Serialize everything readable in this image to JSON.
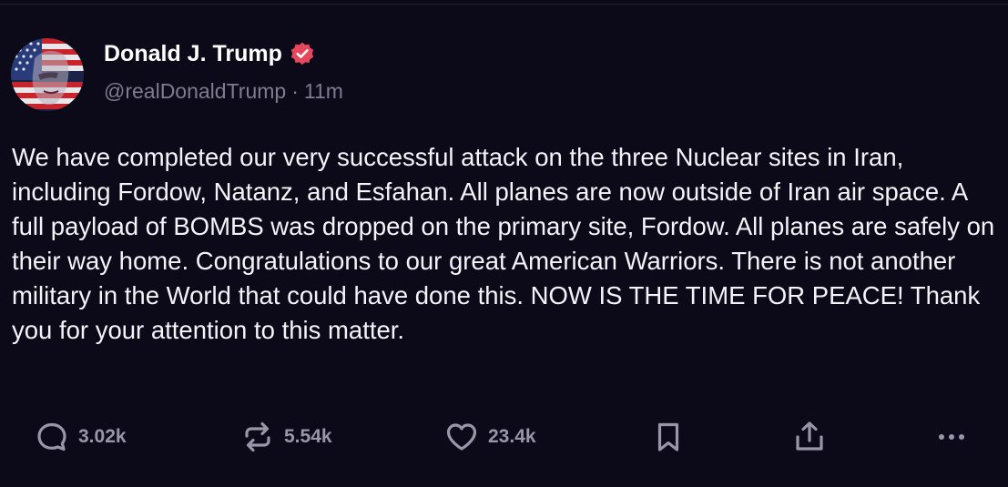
{
  "author": {
    "display_name": "Donald J. Trump",
    "handle": "@realDonaldTrump",
    "separator": "·",
    "timestamp": "11m",
    "verified": true,
    "verified_badge_color": "#e5485d",
    "avatar_icon": "avatar-flag-portrait"
  },
  "post": {
    "text": "We have completed our very successful attack on the three Nuclear sites in Iran, including Fordow, Natanz, and Esfahan. All planes are now outside of Iran air space. A full payload of BOMBS was dropped on the primary site, Fordow. All planes are safely on their way home. Congratulations to our great American Warriors. There is not another military in the World that could have done this. NOW IS THE TIME FOR PEACE! Thank you for your attention to this matter."
  },
  "actions": {
    "reply": {
      "icon": "reply-icon",
      "count": "3.02k"
    },
    "repost": {
      "icon": "repost-icon",
      "count": "5.54k"
    },
    "like": {
      "icon": "heart-icon",
      "count": "23.4k"
    },
    "bookmark": {
      "icon": "bookmark-icon"
    },
    "share": {
      "icon": "share-icon"
    },
    "more": {
      "icon": "more-horizontal-icon"
    }
  },
  "colors": {
    "background": "#0c0a18",
    "text": "#f4f3f8",
    "muted": "#7e7c8e",
    "action_icon": "#9896a8"
  }
}
